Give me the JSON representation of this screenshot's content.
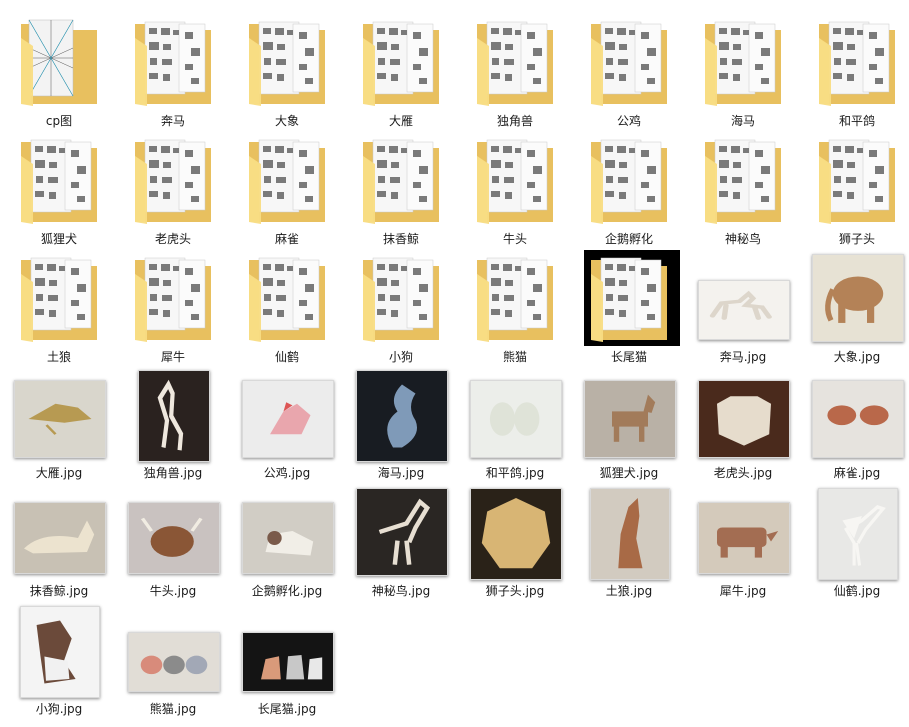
{
  "items": [
    {
      "name": "cp图",
      "type": "folder",
      "variant": "cp"
    },
    {
      "name": "奔马",
      "type": "folder"
    },
    {
      "name": "大象",
      "type": "folder"
    },
    {
      "name": "大雁",
      "type": "folder"
    },
    {
      "name": "独角兽",
      "type": "folder"
    },
    {
      "name": "公鸡",
      "type": "folder"
    },
    {
      "name": "海马",
      "type": "folder"
    },
    {
      "name": "和平鸽",
      "type": "folder"
    },
    {
      "name": "狐狸犬",
      "type": "folder"
    },
    {
      "name": "老虎头",
      "type": "folder"
    },
    {
      "name": "麻雀",
      "type": "folder"
    },
    {
      "name": "抹香鲸",
      "type": "folder"
    },
    {
      "name": "牛头",
      "type": "folder"
    },
    {
      "name": "企鹅孵化",
      "type": "folder"
    },
    {
      "name": "神秘鸟",
      "type": "folder"
    },
    {
      "name": "狮子头",
      "type": "folder"
    },
    {
      "name": "土狼",
      "type": "folder"
    },
    {
      "name": "犀牛",
      "type": "folder"
    },
    {
      "name": "仙鹤",
      "type": "folder"
    },
    {
      "name": "小狗",
      "type": "folder"
    },
    {
      "name": "熊猫",
      "type": "folder"
    },
    {
      "name": "长尾猫",
      "type": "folder",
      "selected": true
    },
    {
      "name": "奔马.jpg",
      "type": "image",
      "bg": "#f4f2ee",
      "fg": "#ddd6cb",
      "shape": "horse"
    },
    {
      "name": "大象.jpg",
      "type": "image",
      "bg": "#e7e2d4",
      "fg": "#b48257",
      "shape": "elephant"
    },
    {
      "name": "大雁.jpg",
      "type": "image",
      "bg": "#d9d6cc",
      "fg": "#b79a52",
      "shape": "bird"
    },
    {
      "name": "独角兽.jpg",
      "type": "image",
      "bg": "#2a221f",
      "fg": "#efe8de",
      "shape": "unicorn"
    },
    {
      "name": "公鸡.jpg",
      "type": "image",
      "bg": "#ececec",
      "fg": "#e9a6ad",
      "shape": "rooster"
    },
    {
      "name": "海马.jpg",
      "type": "image",
      "bg": "#181c22",
      "fg": "#7f9ab8",
      "shape": "seahorse"
    },
    {
      "name": "和平鸽.jpg",
      "type": "image",
      "bg": "#eceeea",
      "fg": "#dfe3d8",
      "shape": "doves"
    },
    {
      "name": "狐狸犬.jpg",
      "type": "image",
      "bg": "#b9b1a6",
      "fg": "#a27b5a",
      "shape": "dog"
    },
    {
      "name": "老虎头.jpg",
      "type": "image",
      "bg": "#4a2a1c",
      "fg": "#e6dccc",
      "shape": "tiger"
    },
    {
      "name": "麻雀.jpg",
      "type": "image",
      "bg": "#e6e3de",
      "fg": "#b9684a",
      "shape": "sparrows"
    },
    {
      "name": "抹香鲸.jpg",
      "type": "image",
      "bg": "#c8c1b4",
      "fg": "#ece3cf",
      "shape": "whale"
    },
    {
      "name": "牛头.jpg",
      "type": "image",
      "bg": "#c9c2c0",
      "fg": "#8a5636",
      "shape": "bull"
    },
    {
      "name": "企鹅孵化.jpg",
      "type": "image",
      "bg": "#d1cdc5",
      "fg": "#f1eee7",
      "shape": "egg"
    },
    {
      "name": "神秘鸟.jpg",
      "type": "image",
      "bg": "#2a2623",
      "fg": "#e7dfd2",
      "shape": "mystery"
    },
    {
      "name": "狮子头.jpg",
      "type": "image",
      "bg": "#2a2218",
      "fg": "#d8b574",
      "shape": "lion"
    },
    {
      "name": "土狼.jpg",
      "type": "image",
      "bg": "#d2cbc0",
      "fg": "#a86a46",
      "shape": "coyote"
    },
    {
      "name": "犀牛.jpg",
      "type": "image",
      "bg": "#d4cabb",
      "fg": "#a36d52",
      "shape": "rhino"
    },
    {
      "name": "仙鹤.jpg",
      "type": "image",
      "bg": "#e8e8e6",
      "fg": "#f7f6f3",
      "shape": "crane"
    },
    {
      "name": "小狗.jpg",
      "type": "image",
      "bg": "#f4f4f4",
      "fg": "#6b4a3a",
      "shape": "puppy"
    },
    {
      "name": "熊猫.jpg",
      "type": "image",
      "bg": "#e1ddd6",
      "fg": "#d88b7b",
      "shape": "pandas"
    },
    {
      "name": "长尾猫.jpg",
      "type": "image",
      "bg": "#141414",
      "fg": "#d99a7a",
      "shape": "cats"
    }
  ],
  "colors": {
    "folder_back": "#e8c05f",
    "folder_front": "#f8dc83",
    "selection": "#000000",
    "text": "#1a1a1a"
  }
}
